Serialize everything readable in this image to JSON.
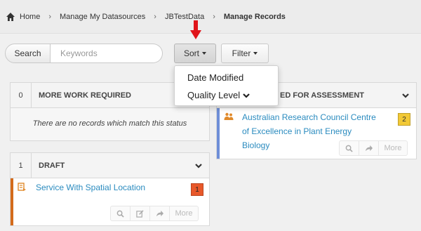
{
  "breadcrumb": {
    "items": [
      "Home",
      "Manage My Datasources",
      "JBTestData"
    ],
    "current": "Manage Records"
  },
  "search": {
    "button_label": "Search",
    "placeholder": "Keywords",
    "value": ""
  },
  "toolbar": {
    "sort_label": "Sort",
    "filter_label": "Filter"
  },
  "sort_menu": {
    "items": [
      "Date Modified",
      "Quality Level"
    ]
  },
  "panels": {
    "more_work": {
      "count": "0",
      "title": "MORE WORK REQUIRED",
      "empty_message": "There are no records which match this status"
    },
    "draft": {
      "count": "1",
      "title": "DRAFT",
      "records": [
        {
          "title": "Service With Spatial Location",
          "quality_level": "1",
          "more_label": "More"
        }
      ]
    },
    "assessment": {
      "title_visible": "ED FOR ASSESSMENT",
      "records": [
        {
          "title_lines": [
            "Australian Research Council Centre",
            "of Excellence in Plant Energy",
            "Biology"
          ],
          "quality_level": "2",
          "more_label": "More"
        }
      ]
    }
  },
  "colors": {
    "link": "#2a8bbf",
    "draft_accent": "#d36b1b",
    "assessment_accent": "#6f8fd8",
    "badge_red": "#e8582a",
    "badge_yellow": "#f2c936",
    "arrow_red": "#e0141a"
  },
  "icons": {
    "home": "home-icon",
    "chevron_down": "chevron-down-icon",
    "search": "search-icon",
    "edit": "edit-icon",
    "share": "share-icon",
    "service": "service-icon",
    "group": "group-icon"
  }
}
